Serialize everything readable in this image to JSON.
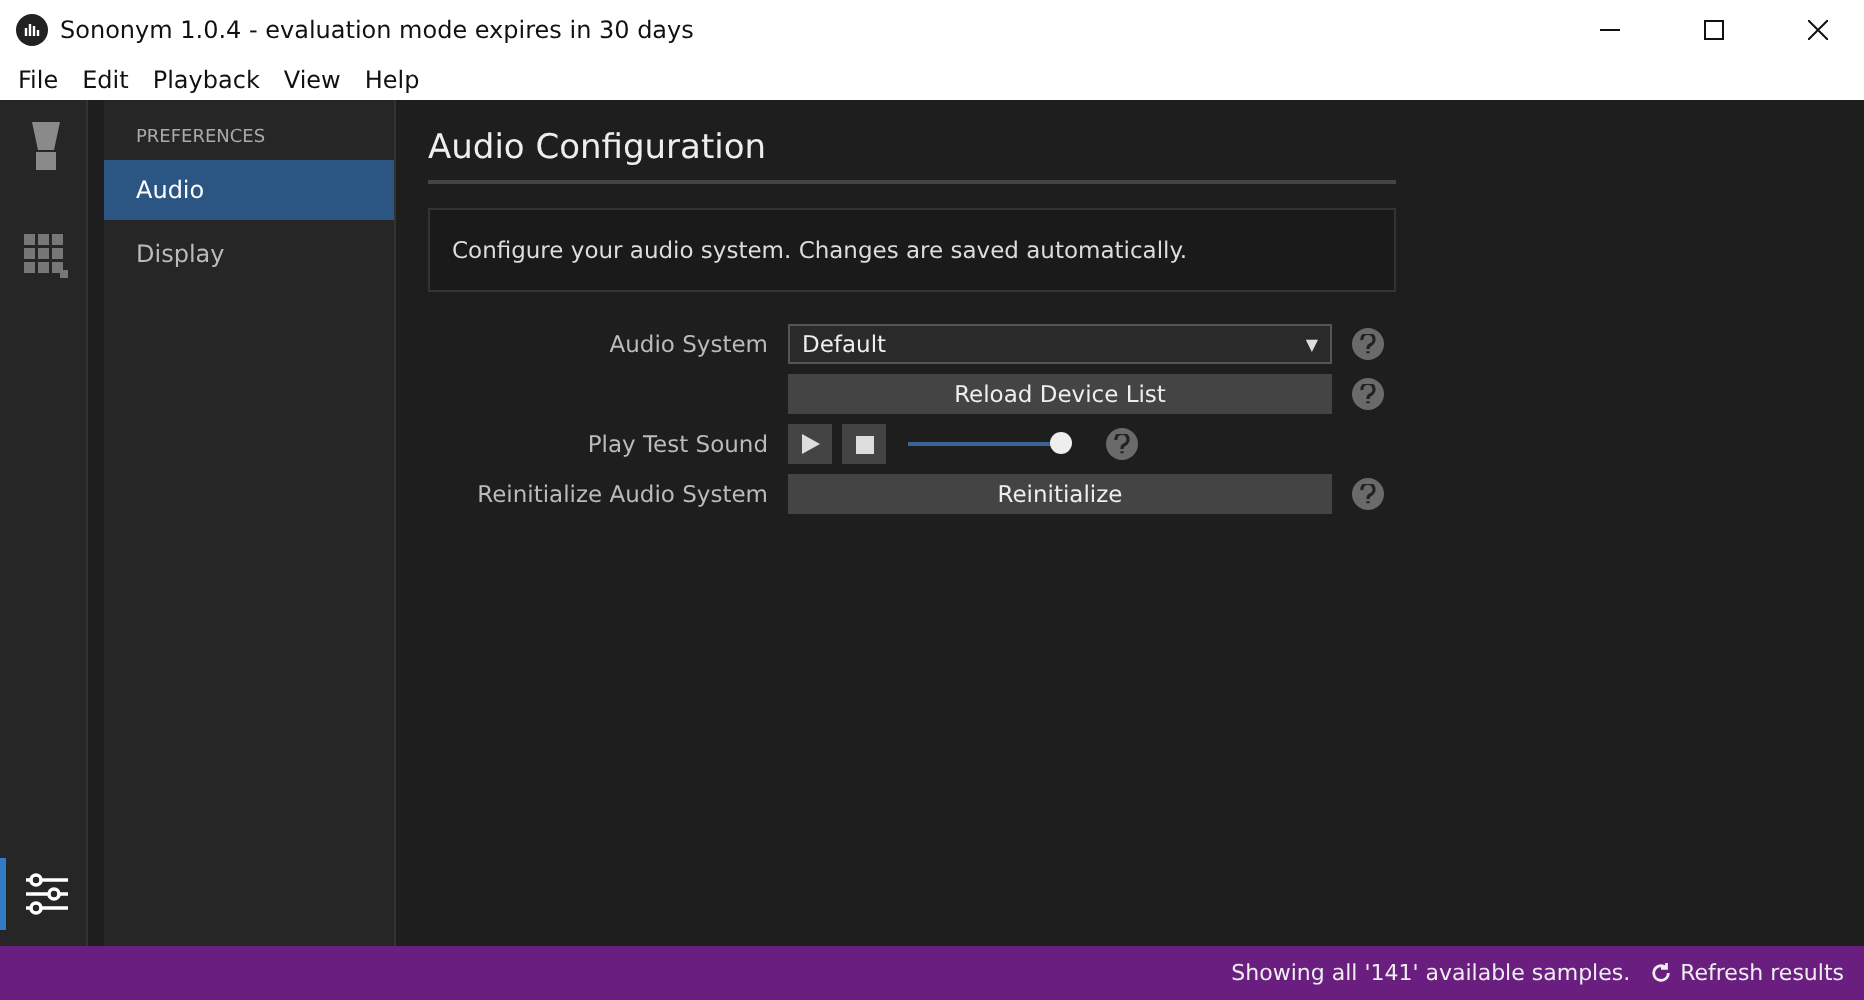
{
  "window": {
    "title": "Sononym 1.0.4 - evaluation mode expires in 30 days"
  },
  "menu": [
    "File",
    "Edit",
    "Playback",
    "View",
    "Help"
  ],
  "rail": [
    {
      "kind": "lamp",
      "selected": false
    },
    {
      "kind": "grid",
      "selected": false
    },
    {
      "kind": "sliders",
      "selected": true
    }
  ],
  "sidebar": {
    "heading": "PREFERENCES",
    "items": [
      {
        "label": "Audio",
        "selected": true
      },
      {
        "label": "Display",
        "selected": false
      }
    ]
  },
  "page": {
    "title": "Audio Configuration",
    "note": "Configure your audio system. Changes are saved automatically.",
    "rows": [
      {
        "kind": "select",
        "label": "Audio System",
        "value": "Default",
        "arrow": "▼"
      },
      {
        "kind": "button",
        "label": "",
        "button": "Reload Device List"
      },
      {
        "kind": "player",
        "label": "Play Test Sound",
        "level": 0.96
      },
      {
        "kind": "button",
        "label": "Reinitialize Audio System",
        "button": "Reinitialize"
      }
    ]
  },
  "status_bar": {
    "text": "Showing all '141' available samples.",
    "refresh": "Refresh results"
  }
}
